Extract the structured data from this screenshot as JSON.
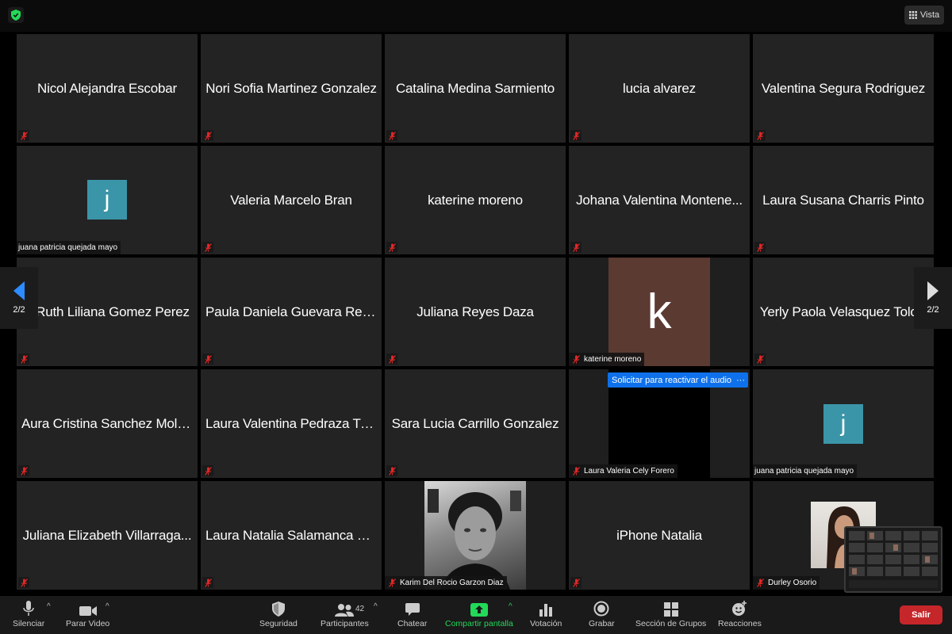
{
  "topbar": {
    "view_label": "Vista"
  },
  "tiles": [
    {
      "name": "Nicol Alejandra Escobar"
    },
    {
      "name": "Nori Sofia Martinez Gonzalez"
    },
    {
      "name": "Catalina Medina Sarmiento"
    },
    {
      "name": "lucia alvarez"
    },
    {
      "name": "Valentina Segura Rodriguez"
    },
    {
      "name": "j",
      "label": "juana patricia quejada mayo",
      "avatar_color": "#3b95a8"
    },
    {
      "name": "Valeria Marcelo Bran"
    },
    {
      "name": "katerine moreno"
    },
    {
      "name": "Johana Valentina Montene..."
    },
    {
      "name": "Laura Susana Charris Pinto"
    },
    {
      "name": "Ruth Liliana Gomez Perez"
    },
    {
      "name": "Paula Daniela Guevara Rest..."
    },
    {
      "name": "Juliana Reyes Daza"
    },
    {
      "name": "k",
      "label": "katerine moreno",
      "avatar_color": "#5b3a31"
    },
    {
      "name": "Yerly Paola Velasquez Toloza"
    },
    {
      "name": "Aura Cristina Sanchez Mola..."
    },
    {
      "name": "Laura Valentina Pedraza Tri..."
    },
    {
      "name": "Sara Lucia Carrillo Gonzalez"
    },
    {
      "label": "Laura Valeria Cely Forero"
    },
    {
      "name": "j",
      "label": "juana patricia quejada mayo",
      "avatar_color": "#3b95a8"
    },
    {
      "name": "Juliana Elizabeth Villarraga..."
    },
    {
      "name": "Laura Natalia Salamanca N..."
    },
    {
      "label": "Karim Del Rocio Garzon Diaz"
    },
    {
      "name": "iPhone Natalia"
    },
    {
      "label": "Durley Osorio"
    }
  ],
  "pager": {
    "left": "2/2",
    "right": "2/2"
  },
  "unmute_request": {
    "label": "Solicitar para reactivar el audio",
    "more": "···"
  },
  "toolbar": {
    "mute": "Silenciar",
    "video": "Parar Video",
    "security": "Seguridad",
    "participants": "Participantes",
    "participants_count": "42",
    "chat": "Chatear",
    "share": "Compartir pantalla",
    "poll": "Votación",
    "record": "Grabar",
    "breakout": "Sección de Grupos",
    "reactions": "Reacciones",
    "leave": "Salir"
  },
  "colors": {
    "share_green": "#23d959",
    "leave_red": "#c5262a",
    "request_blue": "#0e71eb"
  }
}
